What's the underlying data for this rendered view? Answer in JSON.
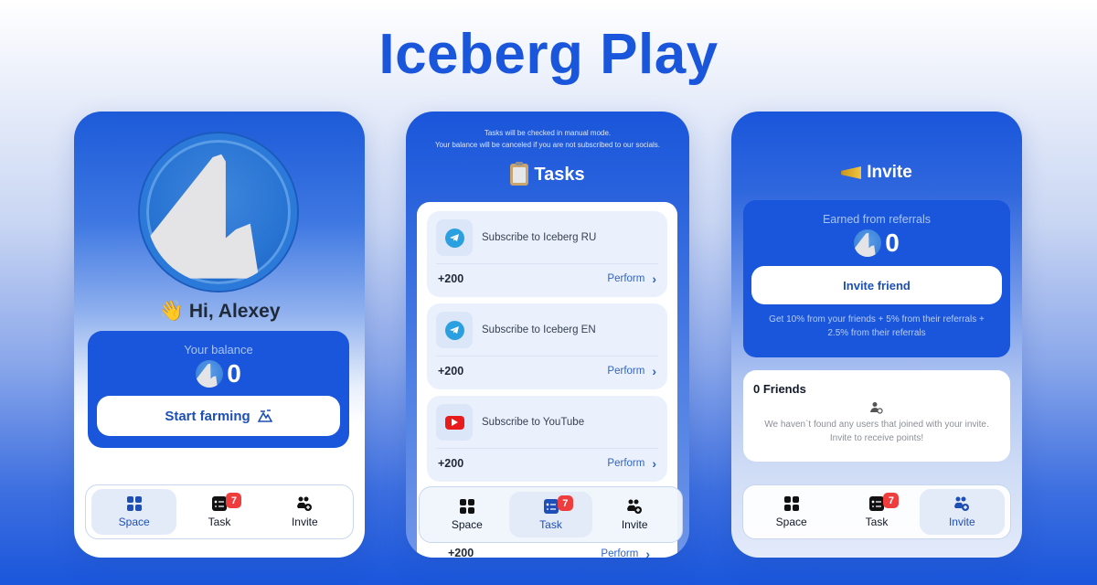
{
  "hero": {
    "title": "Iceberg Play"
  },
  "colors": {
    "brand": "#1a56db",
    "badge": "#ef3d3d",
    "link": "#2f64c4"
  },
  "space_screen": {
    "greeting_emoji": "👋",
    "greeting": "Hi, Alexey",
    "balance_label": "Your balance",
    "balance_value": "0",
    "farm_button": "Start farming",
    "farm_icon": "mountain-icon"
  },
  "tasks_screen": {
    "notice_line1": "Tasks will be checked in manual mode.",
    "notice_line2": "Your balance will be canceled if you are not subscribed to our socials.",
    "title": "Tasks",
    "title_icon": "clipboard-icon",
    "tasks": [
      {
        "name": "Subscribe to Iceberg RU",
        "icon": "telegram-icon",
        "reward": "+200",
        "action": "Perform"
      },
      {
        "name": "Subscribe to Iceberg EN",
        "icon": "telegram-icon",
        "reward": "+200",
        "action": "Perform"
      },
      {
        "name": "Subscribe to YouTube",
        "icon": "youtube-icon",
        "reward": "+200",
        "action": "Perform"
      }
    ],
    "peek_reward": "+200",
    "peek_action": "Perform"
  },
  "invite_screen": {
    "title": "Invite",
    "title_icon": "megaphone-icon",
    "earned_label": "Earned from referrals",
    "earned_value": "0",
    "invite_button": "Invite friend",
    "referral_note": "Get 10% from your friends + 5% from their referrals + 2.5% from their referrals",
    "friends_title": "0 Friends",
    "friends_empty": "We haven`t found any users that joined with your invite. Invite to receive points!"
  },
  "nav": {
    "items": [
      {
        "label": "Space",
        "icon": "grid-icon"
      },
      {
        "label": "Task",
        "icon": "task-list-icon",
        "badge": "7"
      },
      {
        "label": "Invite",
        "icon": "users-add-icon"
      }
    ]
  }
}
